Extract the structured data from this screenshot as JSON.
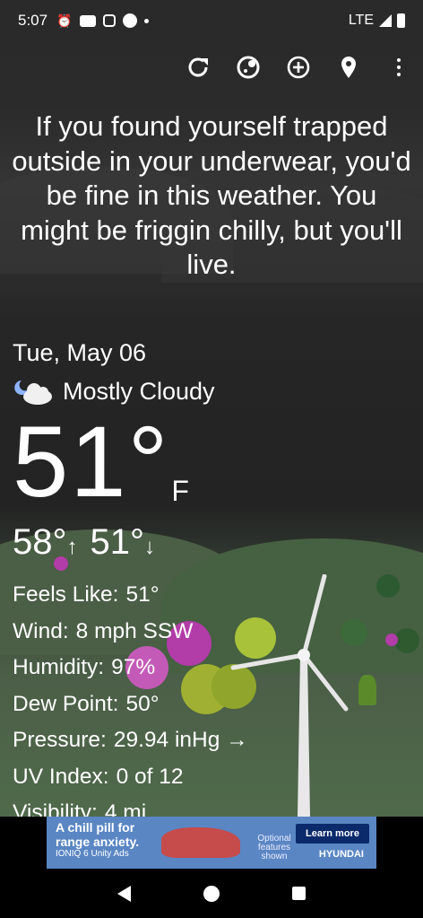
{
  "status_bar": {
    "time": "5:07",
    "network": "LTE",
    "icons": [
      "alarm-icon",
      "youtube-icon",
      "instagram-icon",
      "circle-icon",
      "dot-icon"
    ]
  },
  "toolbar": {
    "icons": [
      "refresh-icon",
      "theme-icon",
      "add-location-icon",
      "location-pin-icon",
      "more-menu-icon"
    ]
  },
  "quote": "If you found yourself trapped outside in your underwear, you'd be fine in this weather. You might be friggin chilly, but you'll live.",
  "weather": {
    "date": "Tue, May 06",
    "condition": "Mostly Cloudy",
    "condition_icon": "moon-cloud-icon",
    "temperature": "51°",
    "unit": "F",
    "high": "58°",
    "high_arrow": "↑",
    "low": "51°",
    "low_arrow": "↓"
  },
  "details": [
    {
      "label": "Feels Like:",
      "value": "51°"
    },
    {
      "label": "Wind:",
      "value": "8 mph SSW"
    },
    {
      "label": "Humidity:",
      "value": "97%"
    },
    {
      "label": "Dew Point:",
      "value": "50°"
    },
    {
      "label": "Pressure:",
      "value": "29.94 inHg →"
    },
    {
      "label": "UV Index:",
      "value": "0 of 12"
    },
    {
      "label": "Visibility:",
      "value": "4 mi"
    }
  ],
  "ad": {
    "headline": "A chill pill for range anxiety.",
    "model": "IONIQ 6",
    "network": "Unity Ads",
    "optional": "Optional features shown",
    "cta": "Learn more",
    "brand": "HYUNDAI"
  },
  "colors": {
    "background_top": "#2a2a2a",
    "hills": "#4f6a4a",
    "ad_bg": "#5a86c4",
    "ad_button": "#0b2a6b"
  }
}
